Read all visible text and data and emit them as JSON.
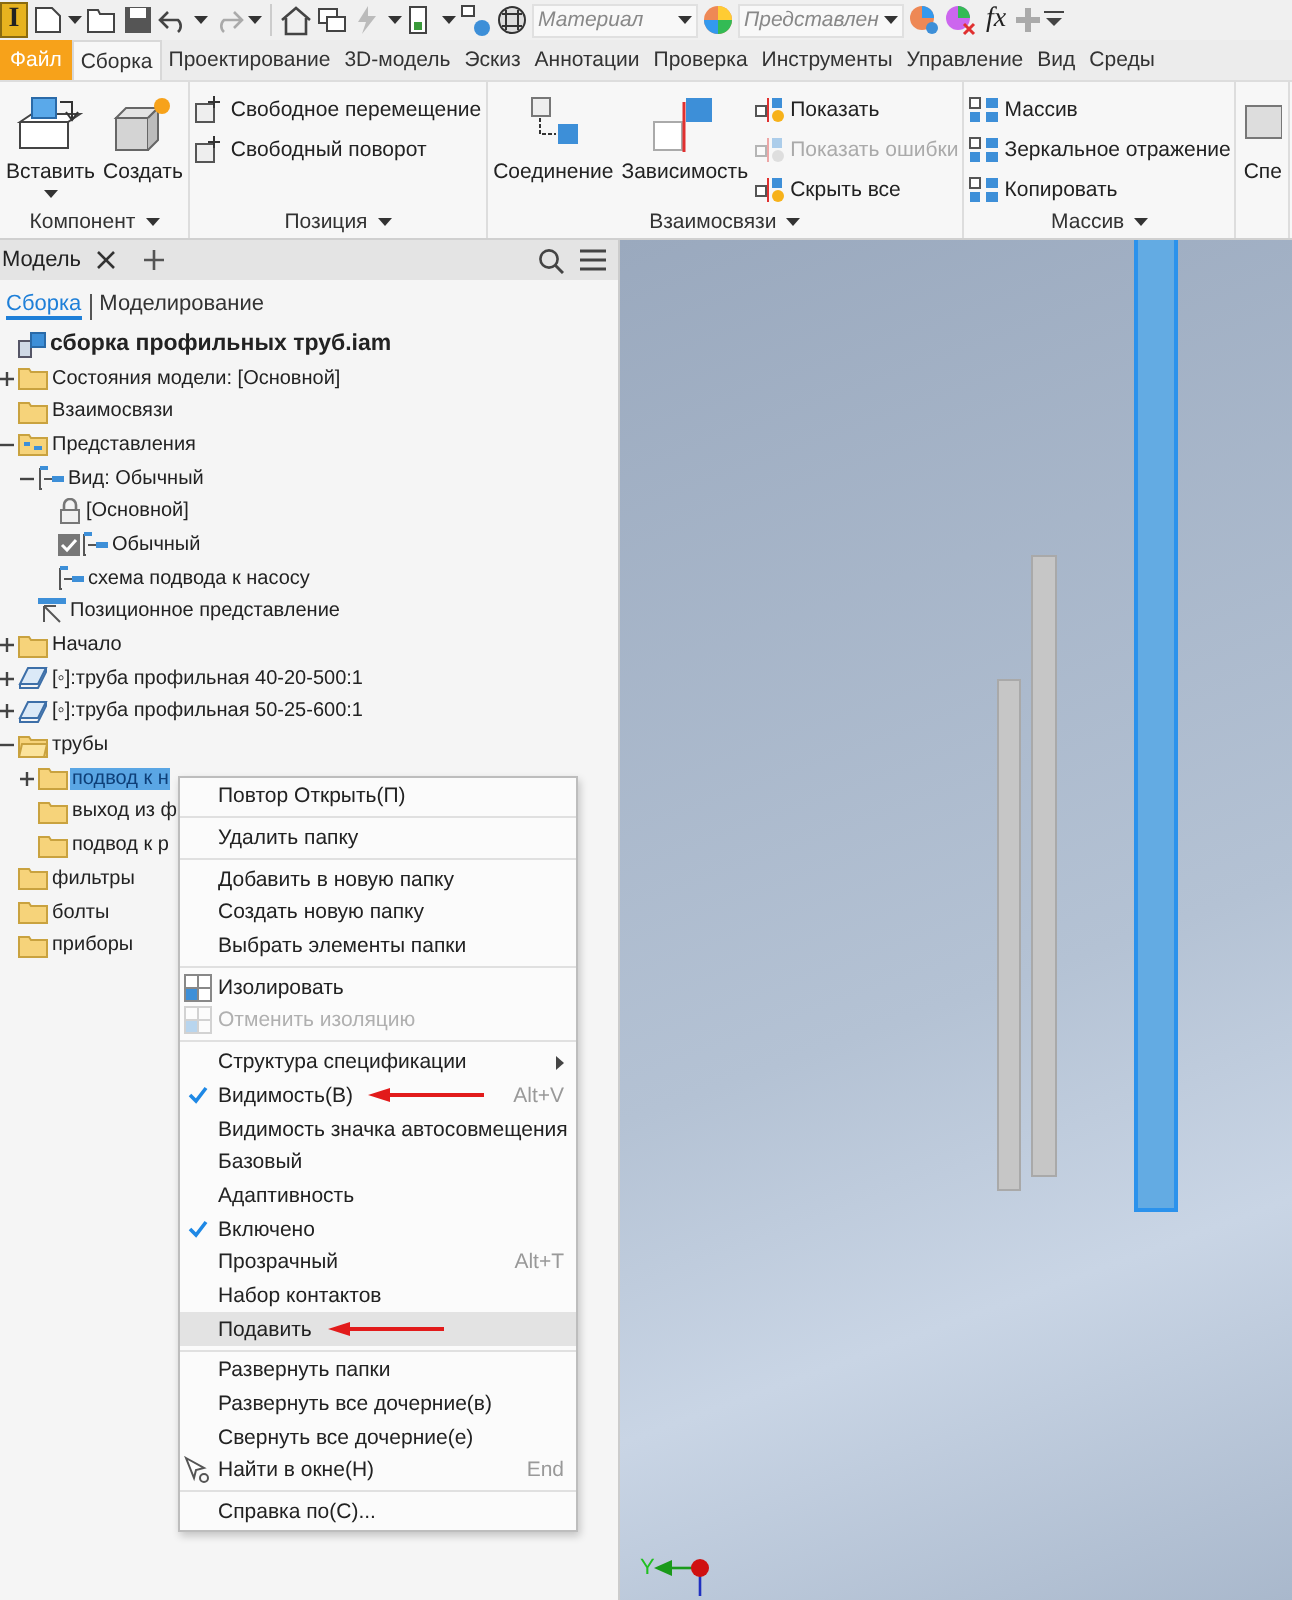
{
  "quick_access": {
    "logo": "I",
    "material_field": {
      "value": "Материал"
    },
    "appearance_field": {
      "value": "Представлен"
    },
    "formula_button": "fx"
  },
  "tabs": [
    {
      "label": "Файл",
      "kind": "file",
      "selected": false
    },
    {
      "label": "Сборка",
      "kind": "tab",
      "selected": true
    },
    {
      "label": "Проектирование",
      "kind": "tab",
      "selected": false
    },
    {
      "label": "3D-модель",
      "kind": "tab",
      "selected": false
    },
    {
      "label": "Эскиз",
      "kind": "tab",
      "selected": false
    },
    {
      "label": "Аннотации",
      "kind": "tab",
      "selected": false
    },
    {
      "label": "Проверка",
      "kind": "tab",
      "selected": false
    },
    {
      "label": "Инструменты",
      "kind": "tab",
      "selected": false
    },
    {
      "label": "Управление",
      "kind": "tab",
      "selected": false
    },
    {
      "label": "Вид",
      "kind": "tab",
      "selected": false
    },
    {
      "label": "Среды",
      "kind": "tab",
      "selected": false
    }
  ],
  "ribbon": {
    "groups": [
      {
        "label": "Компонент",
        "large": [
          {
            "label": "Вставить",
            "dropdown": true
          },
          {
            "label": "Создать",
            "dropdown": false
          }
        ]
      },
      {
        "label": "Позиция",
        "small": [
          {
            "label": "Свободное перемещение",
            "disabled": false
          },
          {
            "label": "Свободный поворот",
            "disabled": false
          }
        ]
      },
      {
        "label": "Взаимосвязи",
        "large": [
          {
            "label": "Соединение",
            "dropdown": false
          },
          {
            "label": "Зависимость",
            "dropdown": false
          }
        ],
        "small": [
          {
            "label": "Показать",
            "disabled": false
          },
          {
            "label": "Показать ошибки",
            "disabled": true
          },
          {
            "label": "Скрыть все",
            "disabled": false
          }
        ]
      },
      {
        "label": "Массив",
        "small": [
          {
            "label": "Массив",
            "disabled": false
          },
          {
            "label": "Зеркальное отражение",
            "disabled": false
          },
          {
            "label": "Копировать",
            "disabled": false
          }
        ]
      },
      {
        "large": [
          {
            "label": "Спе",
            "dropdown": false
          }
        ]
      }
    ]
  },
  "browser": {
    "tab": "Модель",
    "subtabs": [
      {
        "label": "Сборка",
        "selected": true
      },
      {
        "label": "Моделирование",
        "selected": false
      }
    ],
    "tree": [
      {
        "label": "сборка профильных труб.iam",
        "kind": "assembly",
        "children": [
          {
            "label": "Состояния модели: [Основной]",
            "kind": "folder",
            "expanded": false
          },
          {
            "label": "Взаимосвязи",
            "kind": "folder"
          },
          {
            "label": "Представления",
            "kind": "representations",
            "expanded": true,
            "children": [
              {
                "label": "Вид: Обычный",
                "kind": "view",
                "expanded": true,
                "children": [
                  {
                    "label": "[Основной]",
                    "kind": "lock"
                  },
                  {
                    "label": "Обычный",
                    "kind": "view",
                    "checked": true
                  },
                  {
                    "label": "схема подвода к насосу",
                    "kind": "view"
                  }
                ]
              },
              {
                "label": "Позиционное представление",
                "kind": "position"
              }
            ]
          },
          {
            "label": "Начало",
            "kind": "folder",
            "expanded": false
          },
          {
            "label": "[◦]:труба профильная 40-20-500:1",
            "kind": "part",
            "expanded": false
          },
          {
            "label": "[◦]:труба профильная 50-25-600:1",
            "kind": "part",
            "expanded": false
          },
          {
            "label": "трубы",
            "kind": "folder-open",
            "expanded": true,
            "children": [
              {
                "label": "подвод к н",
                "kind": "folder",
                "expanded": false,
                "selected": true
              },
              {
                "label": "выход из ф",
                "kind": "folder",
                "selected": false
              },
              {
                "label": "подвод к р",
                "kind": "folder",
                "selected": false
              }
            ]
          },
          {
            "label": "фильтры",
            "kind": "folder"
          },
          {
            "label": "болты",
            "kind": "folder"
          },
          {
            "label": "приборы",
            "kind": "folder"
          }
        ]
      }
    ]
  },
  "context_menu": [
    {
      "kind": "item",
      "label": "Повтор Открыть(П)"
    },
    {
      "kind": "separator"
    },
    {
      "kind": "item",
      "label": "Удалить папку"
    },
    {
      "kind": "separator"
    },
    {
      "kind": "item",
      "label": "Добавить в новую папку"
    },
    {
      "kind": "item",
      "label": "Создать новую папку"
    },
    {
      "kind": "item",
      "label": "Выбрать элементы папки"
    },
    {
      "kind": "separator"
    },
    {
      "kind": "isolate-item",
      "label": "Изолировать"
    },
    {
      "kind": "unisolate-item",
      "label": "Отменить изоляцию",
      "disabled": true
    },
    {
      "kind": "separator"
    },
    {
      "kind": "item",
      "label": "Структура спецификации",
      "submenu": true
    },
    {
      "kind": "item",
      "label": "Видимость(В)",
      "checked": true,
      "shortcut": "Alt+V",
      "annotated": true
    },
    {
      "kind": "item",
      "label": "Видимость значка автосовмещения"
    },
    {
      "kind": "item",
      "label": "Базовый"
    },
    {
      "kind": "item",
      "label": "Адаптивность"
    },
    {
      "kind": "item",
      "label": "Включено",
      "checked": true
    },
    {
      "kind": "item",
      "label": "Прозрачный",
      "shortcut": "Alt+T"
    },
    {
      "kind": "item",
      "label": "Набор контактов"
    },
    {
      "kind": "item",
      "label": "Подавить",
      "highlighted": true,
      "annotated": true
    },
    {
      "kind": "separator"
    },
    {
      "kind": "item",
      "label": "Развернуть папки"
    },
    {
      "kind": "item",
      "label": "Развернуть все дочерние(в)"
    },
    {
      "kind": "item",
      "label": "Свернуть все дочерние(е)"
    },
    {
      "kind": "find-item",
      "label": "Найти в окне(Н)",
      "shortcut": "End"
    },
    {
      "kind": "separator"
    },
    {
      "kind": "item",
      "label": "Справка по(С)..."
    }
  ],
  "viewport": {
    "axis_label": "Y"
  }
}
